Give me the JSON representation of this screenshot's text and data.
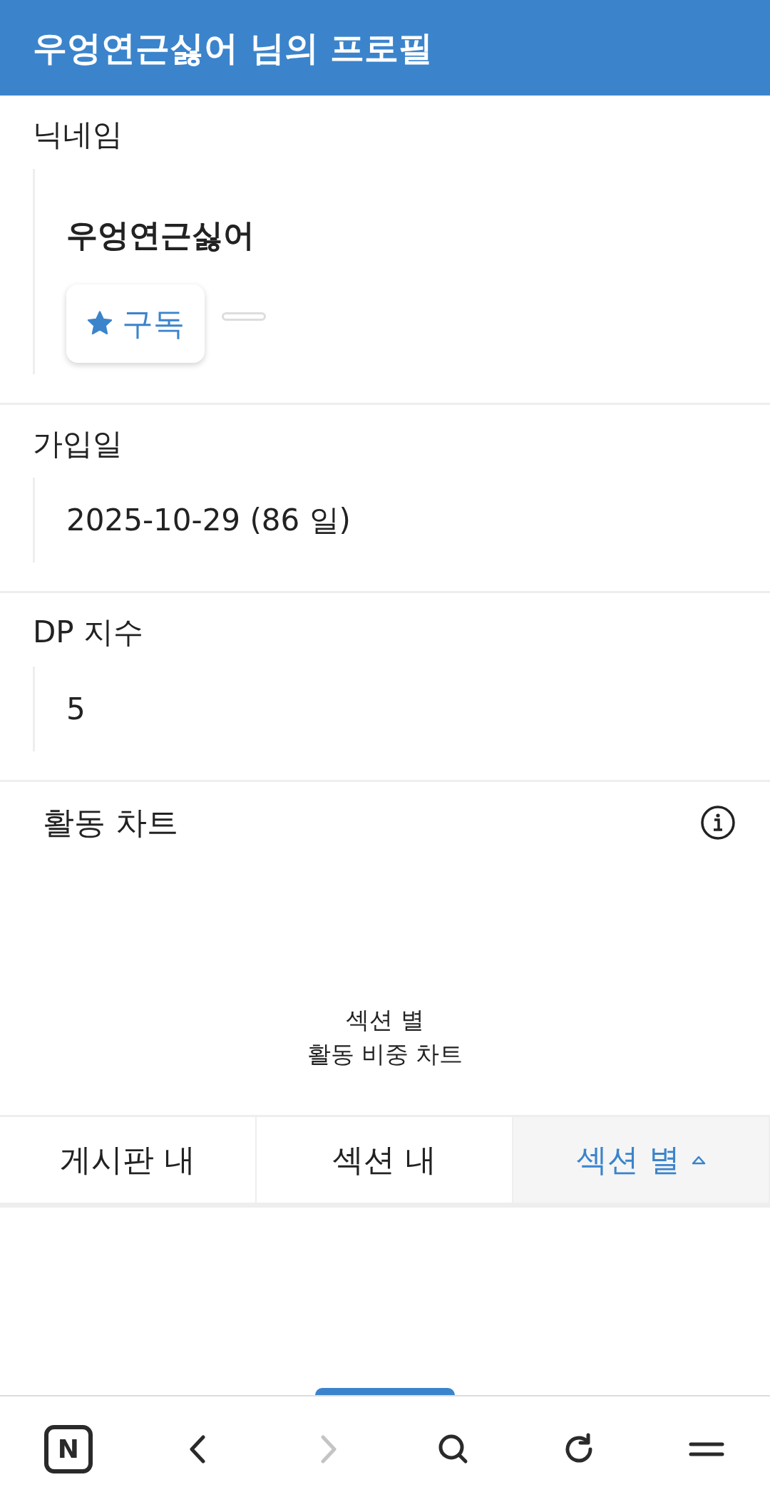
{
  "header": {
    "title": "우엉연근싫어 님의 프로필"
  },
  "fields": [
    {
      "kind": "profile",
      "label": "닉네임",
      "value": "우엉연근싫어",
      "subscribe_button": "구독"
    },
    {
      "kind": "text",
      "label": "가입일",
      "value": "2025-10-29 (86 일)"
    },
    {
      "kind": "text",
      "label": "DP 지수",
      "value": "5"
    }
  ],
  "activity_chart": {
    "title": "활동 차트",
    "caption": [
      "섹션 별",
      "활동 비중 차트"
    ]
  },
  "tabs": [
    {
      "label": "게시판 내",
      "selected": false
    },
    {
      "label": "섹션 내",
      "selected": false
    },
    {
      "label": "섹션 별",
      "selected": true
    }
  ],
  "browser_bar": {
    "home_label": "N",
    "forward_disabled": true
  }
}
